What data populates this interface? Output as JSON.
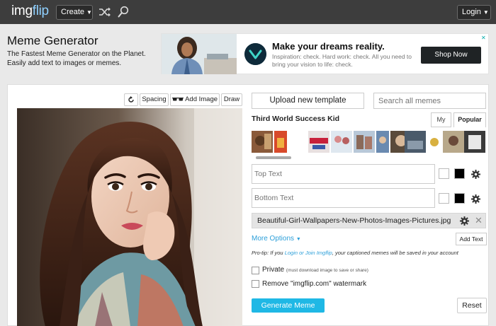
{
  "nav": {
    "logo_prefix": "img",
    "logo_suffix": "flip",
    "create_label": "Create",
    "login_label": "Login",
    "icons": [
      "shuffle-icon",
      "search-icon"
    ]
  },
  "header": {
    "title": "Meme Generator",
    "subtitle": "The Fastest Meme Generator on the Planet. Easily add text to images or memes."
  },
  "ad": {
    "title": "Make your dreams reality.",
    "text": "Inspiration: check. Hard work: check. All you need to bring your vision to life: check.",
    "cta": "Shop Now"
  },
  "toolbar": {
    "spacing_label": "Spacing",
    "add_image_label": "Add Image",
    "draw_label": "Draw"
  },
  "templates": {
    "upload_label": "Upload new template",
    "search_placeholder": "Search all memes",
    "selected_name": "Third World Success Kid",
    "tab_my": "My",
    "tab_popular": "Popular"
  },
  "text_boxes": {
    "top_placeholder": "Top Text",
    "bottom_placeholder": "Bottom Text"
  },
  "file": {
    "name": "Beautiful-Girl-Wallpapers-New-Photos-Images-Pictures.jpg"
  },
  "options": {
    "more_options": "More Options",
    "add_text": "Add Text",
    "protip_prefix": "Pro-tip: If you ",
    "protip_link": "Login or Join Imgflip",
    "protip_suffix": ", your captioned memes will be saved in your account",
    "private_label": "Private",
    "private_note": "(must download image to save or share)",
    "watermark_label": "Remove \"imgflip.com\" watermark",
    "generate_label": "Generate Meme",
    "reset_label": "Reset"
  },
  "colors": {
    "accent": "#1fb8e5",
    "link": "#2c9fd9",
    "nav_bg": "#3d3d3d"
  }
}
